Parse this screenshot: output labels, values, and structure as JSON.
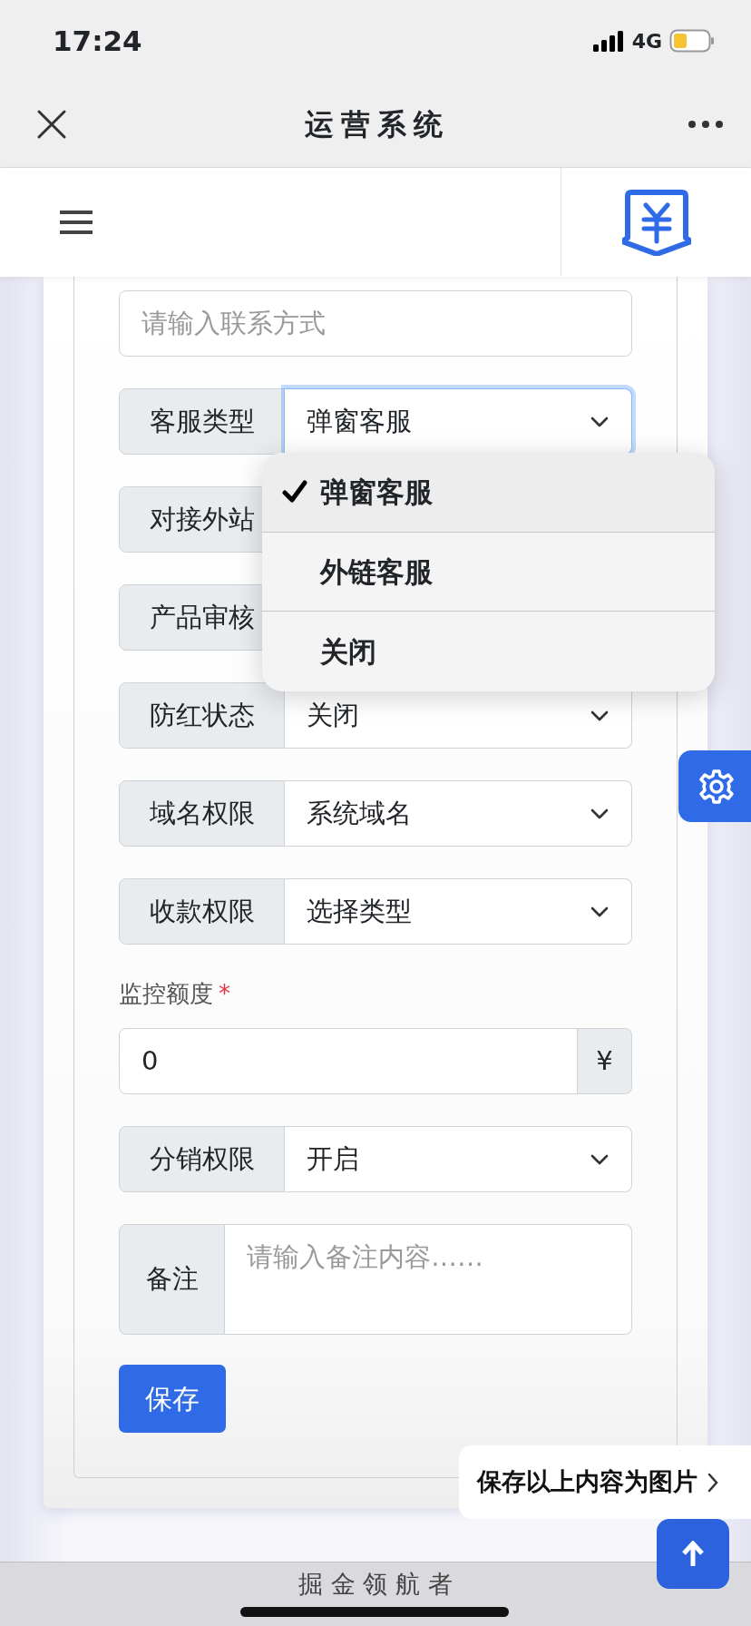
{
  "status_bar": {
    "time": "17:24",
    "network": "4G"
  },
  "nav_bar": {
    "title": "运营系统"
  },
  "form": {
    "fields": [
      {
        "kind": "text",
        "placeholder": "请输入联系方式"
      },
      {
        "kind": "select",
        "label": "客服类型",
        "value": "弹窗客服",
        "focused": true
      },
      {
        "kind": "select",
        "label": "对接外站"
      },
      {
        "kind": "select",
        "label": "产品审核"
      },
      {
        "kind": "select",
        "label": "防红状态",
        "value": "关闭",
        "focused": false
      },
      {
        "kind": "select",
        "label": "域名权限",
        "value": "系统域名",
        "focused": false
      },
      {
        "kind": "select",
        "label": "收款权限",
        "value": "选择类型",
        "focused": false
      },
      {
        "kind": "amount",
        "label": "监控额度",
        "required_mark": "*",
        "value": "0",
        "addon": "¥"
      },
      {
        "kind": "select",
        "label": "分销权限",
        "value": "开启",
        "focused": false
      },
      {
        "kind": "textarea",
        "label": "备注",
        "placeholder": "请输入备注内容……"
      }
    ],
    "save_button": "保存"
  },
  "dropdown": {
    "options": [
      {
        "label": "弹窗客服",
        "selected": true
      },
      {
        "label": "外链客服",
        "selected": false
      },
      {
        "label": "关闭",
        "selected": false
      }
    ]
  },
  "save_image_prompt": "保存以上内容为图片",
  "footer": {
    "text": "掘 金 领 航 者"
  }
}
